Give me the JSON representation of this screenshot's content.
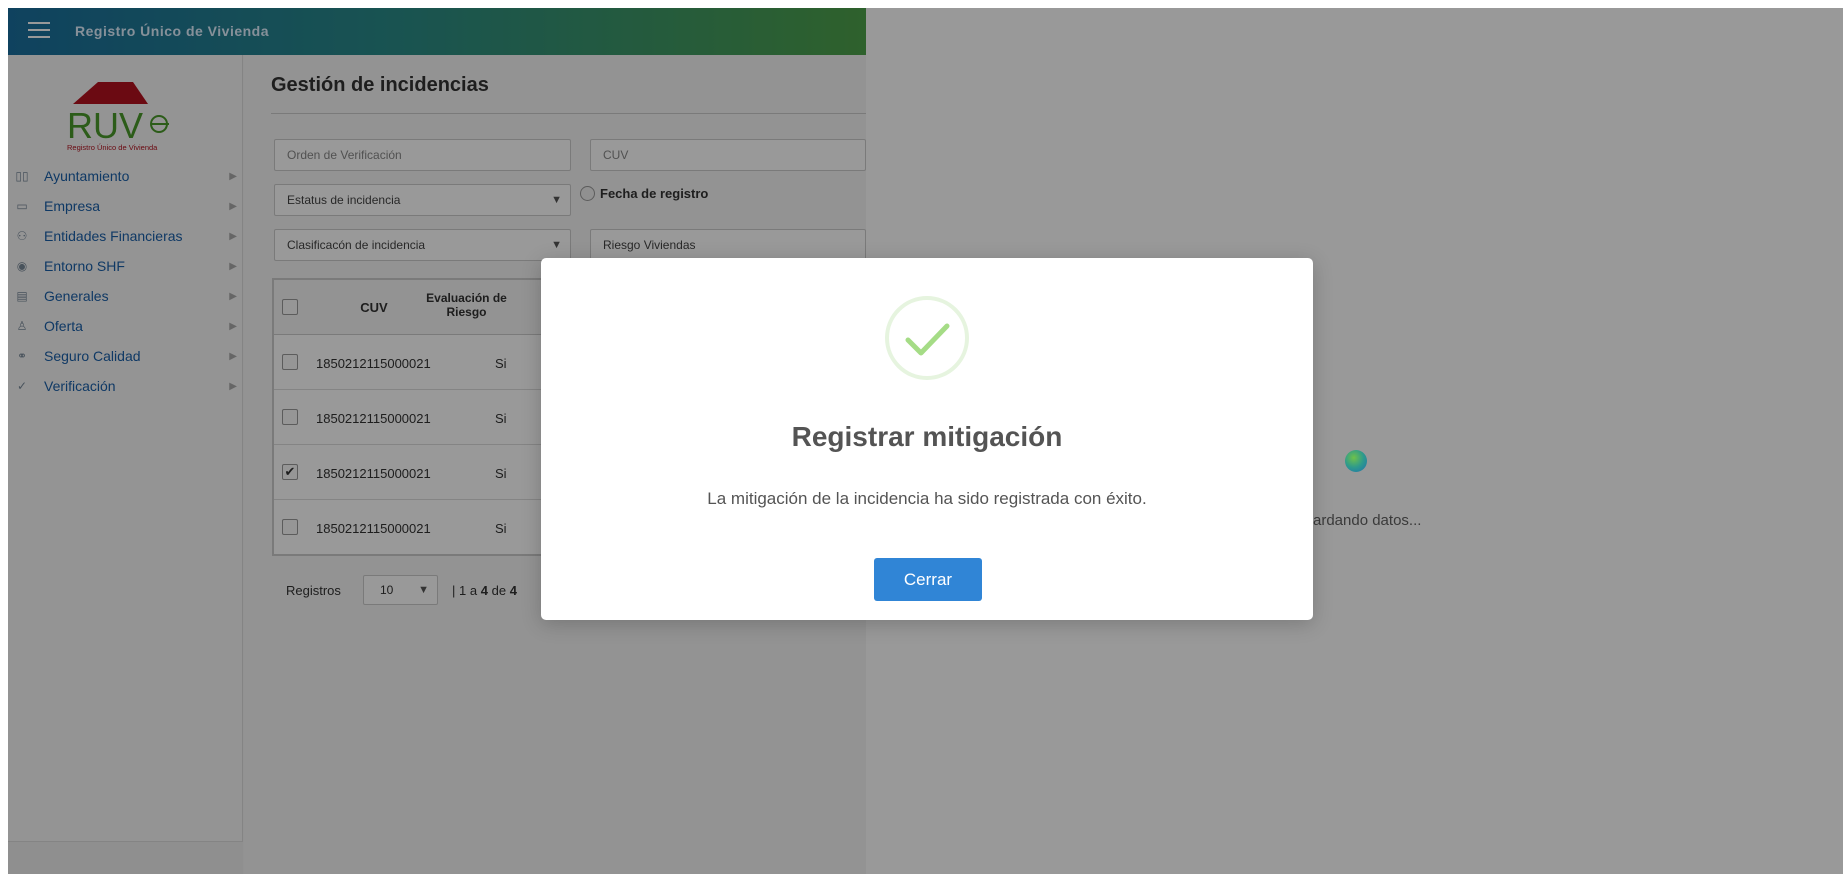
{
  "topbar": {
    "title": "Registro Único de Vivienda"
  },
  "logo": {
    "text": "RUV",
    "subtext": "Registro Único de Vivienda"
  },
  "sidebar": {
    "items": [
      {
        "label": "Ayuntamiento",
        "icon": "map-icon"
      },
      {
        "label": "Empresa",
        "icon": "id-card-icon"
      },
      {
        "label": "Entidades Financieras",
        "icon": "users-icon"
      },
      {
        "label": "Entorno SHF",
        "icon": "target-icon"
      },
      {
        "label": "Generales",
        "icon": "document-icon"
      },
      {
        "label": "Oferta",
        "icon": "person-icon"
      },
      {
        "label": "Seguro Calidad",
        "icon": "handshake-icon"
      },
      {
        "label": "Verificación",
        "icon": "check-circle-icon"
      }
    ]
  },
  "main": {
    "title": "Gestión de incidencias",
    "filters": {
      "orden_placeholder": "Orden de Verificación",
      "cuv_placeholder": "CUV",
      "estatus_label": "Estatus de incidencia",
      "fecha_label": "Fecha de registro",
      "clasificacion_label": "Clasificacón de incidencia",
      "riesgo_label": "Riesgo Viviendas"
    },
    "table": {
      "headers": {
        "cuv": "CUV",
        "evaluacion_line1": "Evaluación de",
        "evaluacion_line2": "Riesgo"
      },
      "rows": [
        {
          "cuv": "1850212115000021",
          "evaluacion": "Si",
          "checked": false
        },
        {
          "cuv": "1850212115000021",
          "evaluacion": "Si",
          "checked": false
        },
        {
          "cuv": "1850212115000021",
          "evaluacion": "Si",
          "checked": true
        },
        {
          "cuv": "1850212115000021",
          "evaluacion": "Si",
          "checked": false
        }
      ]
    },
    "pager": {
      "label": "Registros",
      "page_size": "10",
      "sep": "|",
      "from": "1",
      "a": "a",
      "to": "4",
      "de": "de",
      "total": "4"
    }
  },
  "loader": {
    "text": "ardando datos..."
  },
  "modal": {
    "title": "Registrar mitigación",
    "message": "La mitigación de la incidencia ha sido registrada con éxito.",
    "button": "Cerrar",
    "icon": "success-check-icon",
    "colors": {
      "button": "#3085d6",
      "check": "#a5dc86"
    }
  }
}
